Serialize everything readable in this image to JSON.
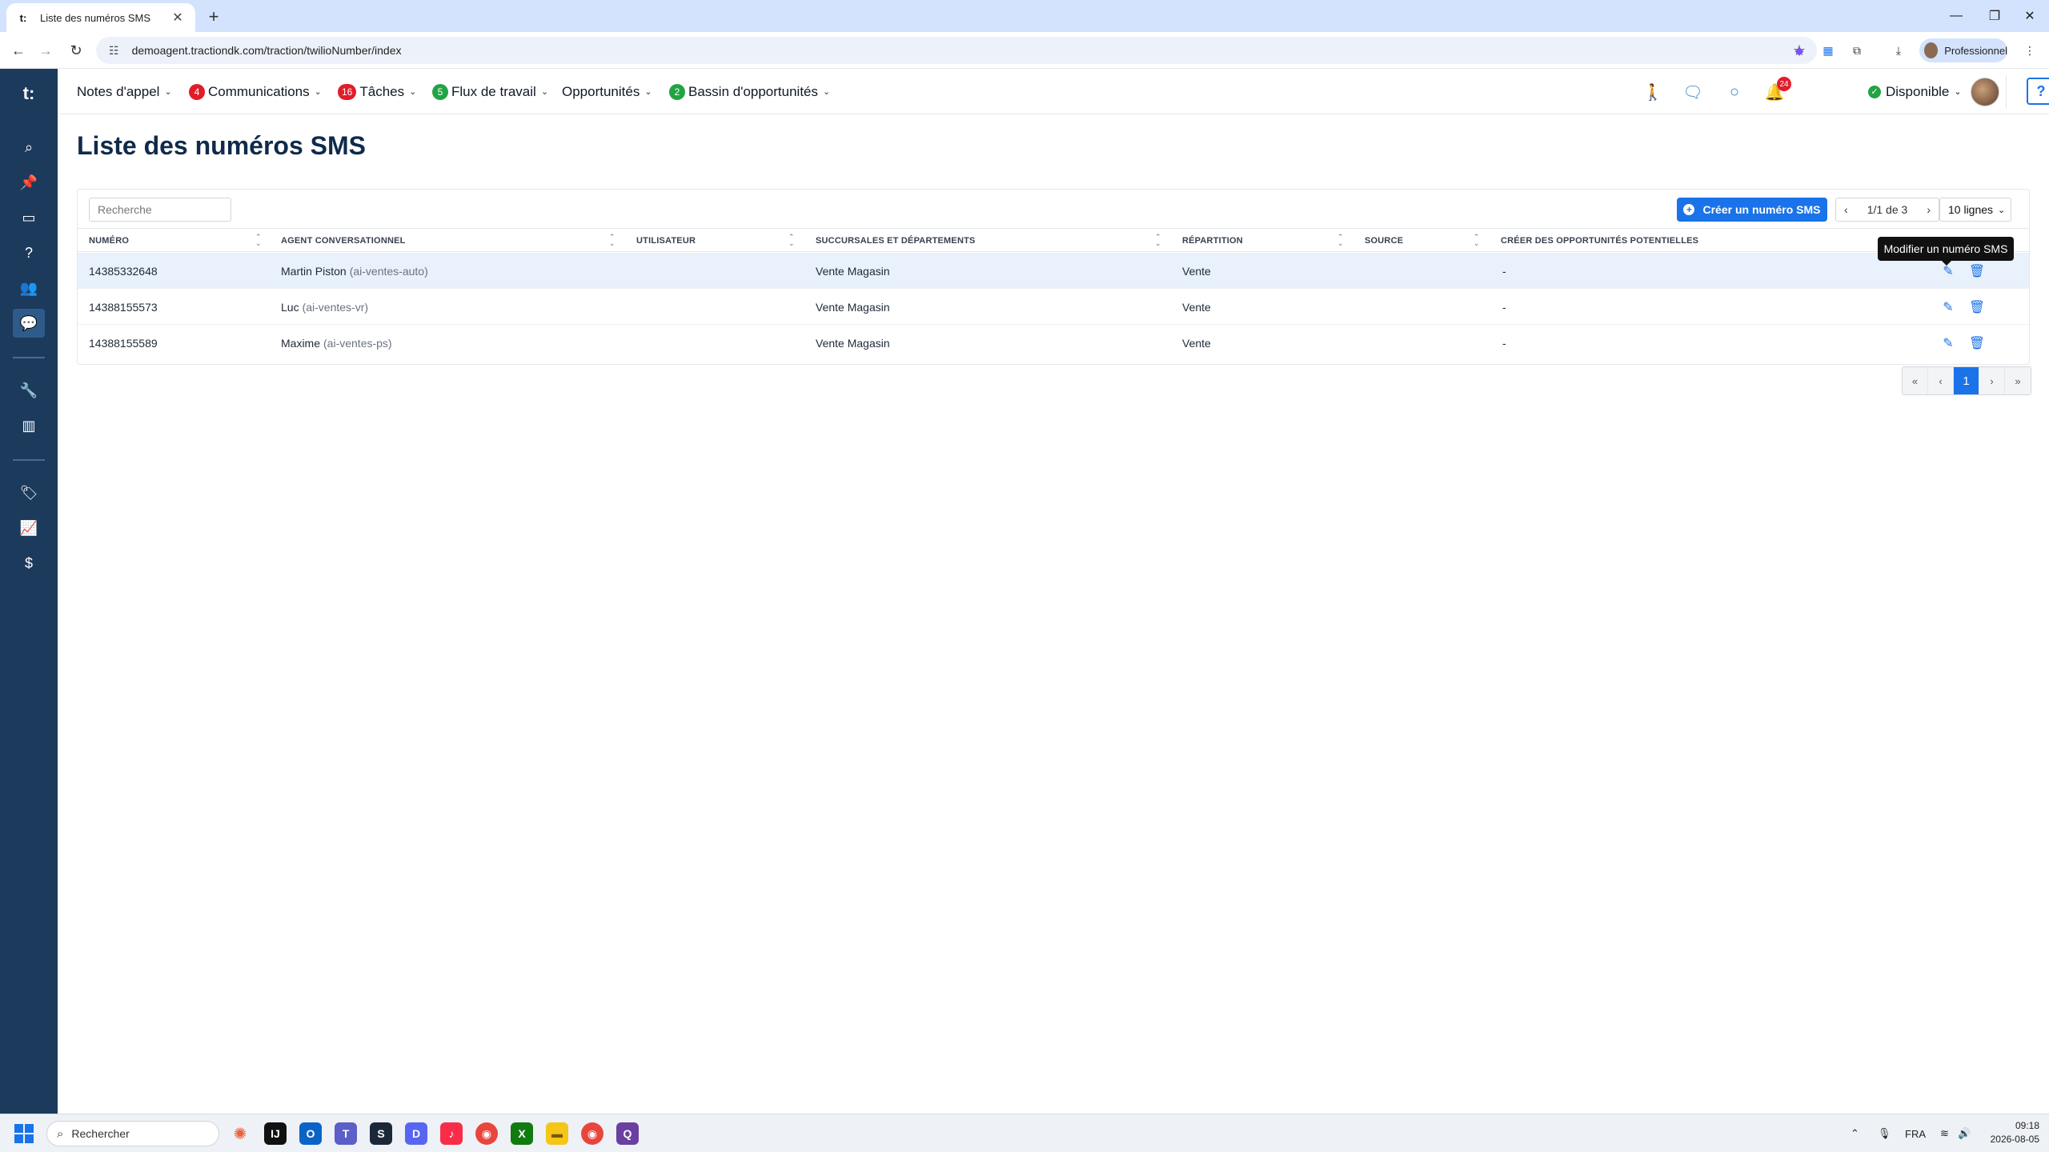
{
  "browser": {
    "tab_title": "Liste des numéros SMS",
    "url": "demoagent.tractiondk.com/traction/twilioNumber/index",
    "profile_label": "Professionnel"
  },
  "app": {
    "logo": "t:",
    "nav": {
      "notes": "Notes d'appel",
      "communications": "Communications",
      "communications_count": "4",
      "taches": "Tâches",
      "taches_count": "16",
      "flux": "Flux de travail",
      "flux_count": "5",
      "opportunites": "Opportunités",
      "bassin": "Bassin d'opportunités",
      "bassin_count": "2",
      "notifications_count": "24",
      "status": "Disponible",
      "help": "?"
    },
    "sidebar_icons": [
      "search-icon",
      "pin-icon",
      "monitor-icon",
      "help-circle-icon",
      "users-icon",
      "chat-icon",
      "wrench-icon",
      "board-icon",
      "tag-icon",
      "chart-icon",
      "dollar-icon"
    ]
  },
  "page": {
    "title": "Liste des numéros SMS",
    "search_placeholder": "Recherche",
    "create_button": "Créer un numéro SMS",
    "pager_text": "1/1 de 3",
    "rows_select": "10 lignes",
    "tooltip": "Modifier un numéro SMS",
    "columns": [
      "Numéro",
      "Agent conversationnel",
      "Utilisateur",
      "Succursales et départements",
      "Répartition",
      "Source",
      "Créer des opportunités potentielles"
    ],
    "rows": [
      {
        "numero": "14385332648",
        "agent": "Martin Piston",
        "agent_id": "(ai-ventes-auto)",
        "utilisateur": "",
        "succursale": "Vente Magasin",
        "repartition": "Vente",
        "source": "",
        "creer": "-"
      },
      {
        "numero": "14388155573",
        "agent": "Luc",
        "agent_id": "(ai-ventes-vr)",
        "utilisateur": "",
        "succursale": "Vente Magasin",
        "repartition": "Vente",
        "source": "",
        "creer": "-"
      },
      {
        "numero": "14388155589",
        "agent": "Maxime",
        "agent_id": "(ai-ventes-ps)",
        "utilisateur": "",
        "succursale": "Vente Magasin",
        "repartition": "Vente",
        "source": "",
        "creer": "-"
      }
    ],
    "pagination": {
      "first": "«",
      "prev": "‹",
      "current": "1",
      "next": "›",
      "last": "»"
    }
  },
  "taskbar": {
    "search_label": "Rechercher",
    "language": "FRA",
    "time": "09:18",
    "date": "2026-08-05"
  }
}
